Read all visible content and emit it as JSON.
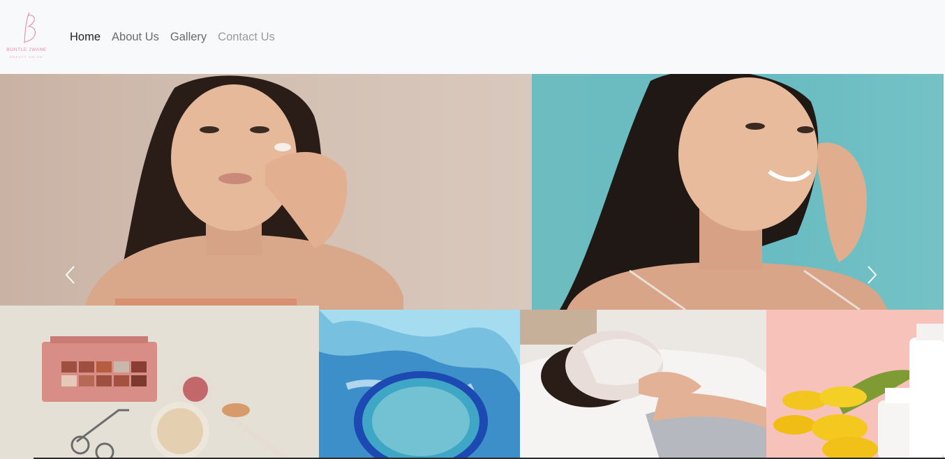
{
  "brand": {
    "name": "BONTLE JWANE",
    "tagline": "BEAUTY SALON",
    "logo_icon": "script-b-logo",
    "accent_color": "#e98aa6"
  },
  "nav": {
    "items": [
      {
        "label": "Home",
        "state": "active"
      },
      {
        "label": "About Us",
        "state": "normal"
      },
      {
        "label": "Gallery",
        "state": "normal"
      },
      {
        "label": "Contact Us",
        "state": "muted"
      }
    ]
  },
  "carousel": {
    "slides": [
      {
        "image": "woman-applying-cream-beige-background"
      },
      {
        "image": "woman-smiling-touching-nose-teal-background"
      }
    ],
    "prev_icon": "chevron-left-icon",
    "next_icon": "chevron-right-icon"
  },
  "gallery": {
    "tiles": [
      {
        "image": "makeup-palette-brush-eyelash-curler"
      },
      {
        "image": "blue-ink-jar-of-gel-patches"
      },
      {
        "image": "woman-with-sheet-mask-in-bed"
      },
      {
        "image": "yellow-tulips-with-cream-bottles"
      }
    ]
  }
}
